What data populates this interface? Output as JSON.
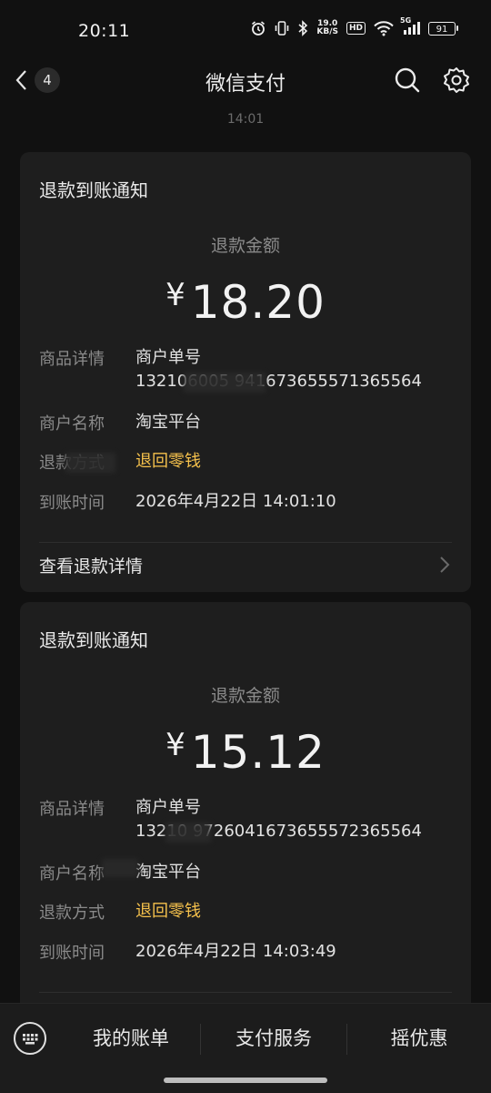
{
  "status_bar": {
    "time": "20:11",
    "net_speed_value": "19.0",
    "net_speed_unit": "KB/S",
    "hd_label": "HD",
    "network_label": "5G",
    "battery_level": "91"
  },
  "nav": {
    "back_count": "4",
    "title": "微信支付"
  },
  "chat": {
    "timestamp": "14:01"
  },
  "messages": [
    {
      "title": "退款到账通知",
      "amount_label": "退款金额",
      "currency": "¥",
      "amount": "18.20",
      "product_label": "商品详情",
      "product_value_line1": "商户单号",
      "product_value_line2": "132106005 9416736555713655​64",
      "merchant_label": "商户名称",
      "merchant_value": "淘宝平台",
      "method_label": "退款方式",
      "method_value": "退回零钱",
      "time_label": "到账时间",
      "time_value": "2026年4月22日 14:01:10",
      "detail_link": "查看退款详情"
    },
    {
      "title": "退款到账通知",
      "amount_label": "退款金额",
      "currency": "¥",
      "amount": "15.12",
      "product_label": "商品详情",
      "product_value_line1": "商户单号",
      "product_value_line2": "13210 9726041673655572365564",
      "merchant_label": "商户名称",
      "merchant_value": "淘宝平台",
      "method_label": "退款方式",
      "method_value": "退回零钱",
      "time_label": "到账时间",
      "time_value": "2026年4月22日 14:03:49"
    }
  ],
  "bottom_menu": {
    "items": [
      "我的账单",
      "支付服务",
      "摇优惠"
    ]
  },
  "colors": {
    "background": "#111111",
    "card": "#1e1e1e",
    "highlight": "#f5c14c",
    "muted": "#8a8a8a"
  }
}
